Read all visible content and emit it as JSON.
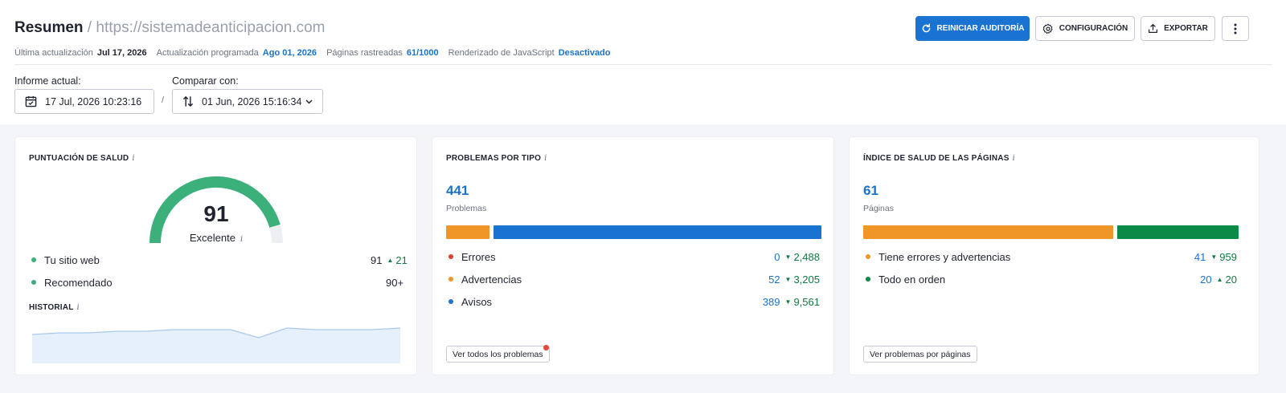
{
  "header": {
    "title": "Resumen",
    "separator": " / ",
    "url": "https://sistemadeanticipacion.com",
    "meta": {
      "last_update_label": "Última actualización",
      "last_update_value": "Jul 17, 2026",
      "scheduled_label": "Actualización programada",
      "scheduled_value": "Ago 01, 2026",
      "crawled_label": "Páginas rastreadas",
      "crawled_value": "61/1000",
      "js_label": "Renderizado de JavaScript",
      "js_value": "Desactivado"
    },
    "buttons": {
      "restart": "REINICIAR AUDITORÍA",
      "config": "CONFIGURACIÓN",
      "export": "EXPORTAR"
    }
  },
  "reports": {
    "current_label": "Informe actual:",
    "current_value": "17 Jul, 2026 10:23:16",
    "separator": "/",
    "compare_label": "Comparar con:",
    "compare_value": "01 Jun, 2026 15:16:34"
  },
  "health": {
    "title": "PUNTUACIÓN DE SALUD",
    "info": "i",
    "score": "91",
    "score_value": 91,
    "score_label": "Excelente",
    "rows": [
      {
        "label": "Tu sitio web",
        "value": "91",
        "delta": "21",
        "delta_dir": "up"
      },
      {
        "label": "Recomendado",
        "value": "90+"
      }
    ],
    "history_title": "HISTORIAL",
    "history_values": [
      88,
      89,
      89,
      90,
      90,
      91,
      91,
      91,
      86,
      92,
      91,
      91,
      91,
      92
    ],
    "colors": {
      "gauge": "#3bb07a",
      "gauge_track": "#eeeff2",
      "history_fill": "#e5f0fb",
      "history_line": "#a9c9ec",
      "dot": "#3bb07a"
    }
  },
  "problems": {
    "title": "PROBLEMAS POR TIPO",
    "info": "i",
    "total": "441",
    "total_label": "Problemas",
    "bar": [
      {
        "name": "Errores",
        "value": 0,
        "color": "#d9412f"
      },
      {
        "name": "Advertencias",
        "value": 52,
        "color": "#f09527"
      },
      {
        "name": "Avisos",
        "value": 389,
        "color": "#1b73d1"
      }
    ],
    "rows": [
      {
        "label": "Errores",
        "value": "0",
        "delta": "2,488",
        "delta_dir": "down",
        "color": "#d9412f"
      },
      {
        "label": "Advertencias",
        "value": "52",
        "delta": "3,205",
        "delta_dir": "down",
        "color": "#f09527"
      },
      {
        "label": "Avisos",
        "value": "389",
        "delta": "9,561",
        "delta_dir": "down",
        "color": "#1b73d1"
      }
    ],
    "button": "Ver todos los problemas"
  },
  "pages": {
    "title": "ÍNDICE DE SALUD DE LAS PÁGINAS",
    "info": "i",
    "total": "61",
    "total_label": "Páginas",
    "bar": [
      {
        "name": "Tiene errores y advertencias",
        "value": 41,
        "color": "#f09527"
      },
      {
        "name": "Todo en orden",
        "value": 20,
        "color": "#0a8a46"
      }
    ],
    "rows": [
      {
        "label": "Tiene errores y advertencias",
        "value": "41",
        "delta": "959",
        "delta_dir": "down",
        "color": "#f09527"
      },
      {
        "label": "Todo en orden",
        "value": "20",
        "delta": "20",
        "delta_dir": "up",
        "color": "#0a8a46"
      }
    ],
    "button": "Ver problemas por páginas"
  }
}
